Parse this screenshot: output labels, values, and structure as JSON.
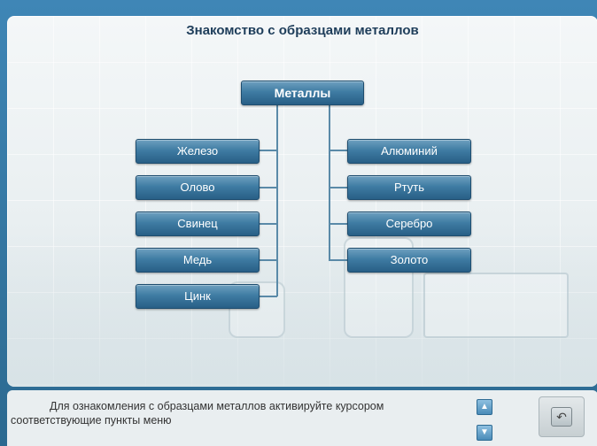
{
  "title": "Знакомство с образцами металлов",
  "root": {
    "label": "Металлы"
  },
  "left_items": [
    {
      "label": "Железо"
    },
    {
      "label": "Олово"
    },
    {
      "label": "Свинец"
    },
    {
      "label": "Медь"
    },
    {
      "label": "Цинк"
    }
  ],
  "right_items": [
    {
      "label": "Алюминий"
    },
    {
      "label": "Ртуть"
    },
    {
      "label": "Серебро"
    },
    {
      "label": "Золото"
    }
  ],
  "footer": {
    "hint_line1": "Для ознакомления с образцами металлов активируйте курсором",
    "hint_line2": "соответствующие пункты меню",
    "scroll_up_icon": "arrow-up-icon",
    "scroll_down_icon": "arrow-down-icon",
    "back_icon": "back-arrow-icon"
  },
  "colors": {
    "button_top": "#6e9fbf",
    "button_bottom": "#285f86",
    "title_text": "#1e3d5a",
    "connector": "#5a8aa8"
  }
}
